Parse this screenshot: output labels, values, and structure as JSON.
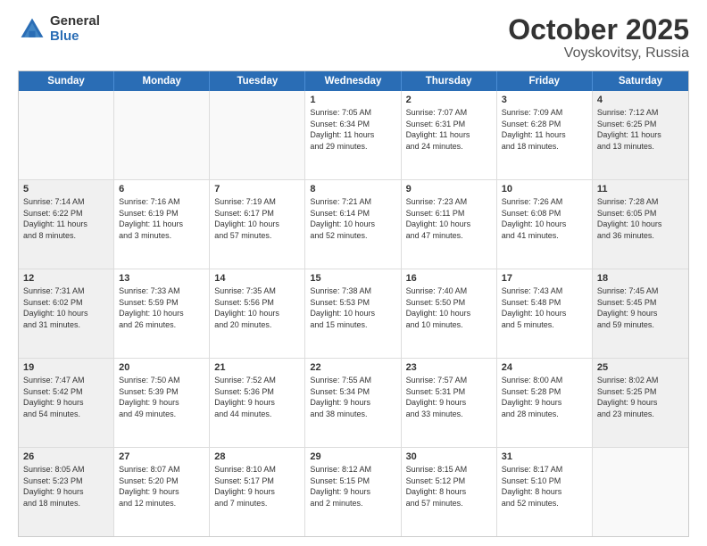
{
  "header": {
    "logo_general": "General",
    "logo_blue": "Blue",
    "title": "October 2025",
    "location": "Voyskovitsy, Russia"
  },
  "weekdays": [
    "Sunday",
    "Monday",
    "Tuesday",
    "Wednesday",
    "Thursday",
    "Friday",
    "Saturday"
  ],
  "rows": [
    [
      {
        "day": "",
        "text": "",
        "empty": true
      },
      {
        "day": "",
        "text": "",
        "empty": true
      },
      {
        "day": "",
        "text": "",
        "empty": true
      },
      {
        "day": "1",
        "text": "Sunrise: 7:05 AM\nSunset: 6:34 PM\nDaylight: 11 hours\nand 29 minutes."
      },
      {
        "day": "2",
        "text": "Sunrise: 7:07 AM\nSunset: 6:31 PM\nDaylight: 11 hours\nand 24 minutes."
      },
      {
        "day": "3",
        "text": "Sunrise: 7:09 AM\nSunset: 6:28 PM\nDaylight: 11 hours\nand 18 minutes."
      },
      {
        "day": "4",
        "text": "Sunrise: 7:12 AM\nSunset: 6:25 PM\nDaylight: 11 hours\nand 13 minutes.",
        "shaded": true
      }
    ],
    [
      {
        "day": "5",
        "text": "Sunrise: 7:14 AM\nSunset: 6:22 PM\nDaylight: 11 hours\nand 8 minutes.",
        "shaded": true
      },
      {
        "day": "6",
        "text": "Sunrise: 7:16 AM\nSunset: 6:19 PM\nDaylight: 11 hours\nand 3 minutes."
      },
      {
        "day": "7",
        "text": "Sunrise: 7:19 AM\nSunset: 6:17 PM\nDaylight: 10 hours\nand 57 minutes."
      },
      {
        "day": "8",
        "text": "Sunrise: 7:21 AM\nSunset: 6:14 PM\nDaylight: 10 hours\nand 52 minutes."
      },
      {
        "day": "9",
        "text": "Sunrise: 7:23 AM\nSunset: 6:11 PM\nDaylight: 10 hours\nand 47 minutes."
      },
      {
        "day": "10",
        "text": "Sunrise: 7:26 AM\nSunset: 6:08 PM\nDaylight: 10 hours\nand 41 minutes."
      },
      {
        "day": "11",
        "text": "Sunrise: 7:28 AM\nSunset: 6:05 PM\nDaylight: 10 hours\nand 36 minutes.",
        "shaded": true
      }
    ],
    [
      {
        "day": "12",
        "text": "Sunrise: 7:31 AM\nSunset: 6:02 PM\nDaylight: 10 hours\nand 31 minutes.",
        "shaded": true
      },
      {
        "day": "13",
        "text": "Sunrise: 7:33 AM\nSunset: 5:59 PM\nDaylight: 10 hours\nand 26 minutes."
      },
      {
        "day": "14",
        "text": "Sunrise: 7:35 AM\nSunset: 5:56 PM\nDaylight: 10 hours\nand 20 minutes."
      },
      {
        "day": "15",
        "text": "Sunrise: 7:38 AM\nSunset: 5:53 PM\nDaylight: 10 hours\nand 15 minutes."
      },
      {
        "day": "16",
        "text": "Sunrise: 7:40 AM\nSunset: 5:50 PM\nDaylight: 10 hours\nand 10 minutes."
      },
      {
        "day": "17",
        "text": "Sunrise: 7:43 AM\nSunset: 5:48 PM\nDaylight: 10 hours\nand 5 minutes."
      },
      {
        "day": "18",
        "text": "Sunrise: 7:45 AM\nSunset: 5:45 PM\nDaylight: 9 hours\nand 59 minutes.",
        "shaded": true
      }
    ],
    [
      {
        "day": "19",
        "text": "Sunrise: 7:47 AM\nSunset: 5:42 PM\nDaylight: 9 hours\nand 54 minutes.",
        "shaded": true
      },
      {
        "day": "20",
        "text": "Sunrise: 7:50 AM\nSunset: 5:39 PM\nDaylight: 9 hours\nand 49 minutes."
      },
      {
        "day": "21",
        "text": "Sunrise: 7:52 AM\nSunset: 5:36 PM\nDaylight: 9 hours\nand 44 minutes."
      },
      {
        "day": "22",
        "text": "Sunrise: 7:55 AM\nSunset: 5:34 PM\nDaylight: 9 hours\nand 38 minutes."
      },
      {
        "day": "23",
        "text": "Sunrise: 7:57 AM\nSunset: 5:31 PM\nDaylight: 9 hours\nand 33 minutes."
      },
      {
        "day": "24",
        "text": "Sunrise: 8:00 AM\nSunset: 5:28 PM\nDaylight: 9 hours\nand 28 minutes."
      },
      {
        "day": "25",
        "text": "Sunrise: 8:02 AM\nSunset: 5:25 PM\nDaylight: 9 hours\nand 23 minutes.",
        "shaded": true
      }
    ],
    [
      {
        "day": "26",
        "text": "Sunrise: 8:05 AM\nSunset: 5:23 PM\nDaylight: 9 hours\nand 18 minutes.",
        "shaded": true
      },
      {
        "day": "27",
        "text": "Sunrise: 8:07 AM\nSunset: 5:20 PM\nDaylight: 9 hours\nand 12 minutes."
      },
      {
        "day": "28",
        "text": "Sunrise: 8:10 AM\nSunset: 5:17 PM\nDaylight: 9 hours\nand 7 minutes."
      },
      {
        "day": "29",
        "text": "Sunrise: 8:12 AM\nSunset: 5:15 PM\nDaylight: 9 hours\nand 2 minutes."
      },
      {
        "day": "30",
        "text": "Sunrise: 8:15 AM\nSunset: 5:12 PM\nDaylight: 8 hours\nand 57 minutes."
      },
      {
        "day": "31",
        "text": "Sunrise: 8:17 AM\nSunset: 5:10 PM\nDaylight: 8 hours\nand 52 minutes."
      },
      {
        "day": "",
        "text": "",
        "empty": true
      }
    ]
  ]
}
